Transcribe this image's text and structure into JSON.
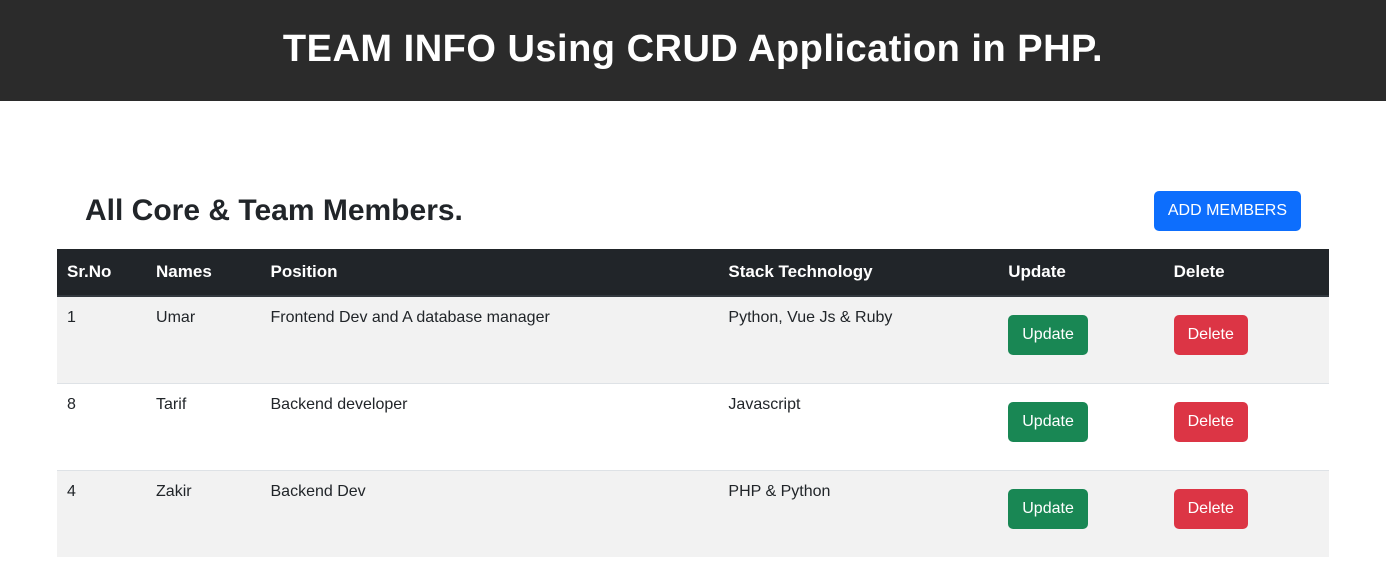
{
  "header": {
    "title": "TEAM INFO Using CRUD Application in PHP."
  },
  "main": {
    "section_title": "All Core & Team Members.",
    "add_button_label": "ADD MEMBERS",
    "columns": {
      "sr": "Sr.No",
      "names": "Names",
      "position": "Position",
      "stack": "Stack Technology",
      "update": "Update",
      "delete": "Delete"
    },
    "buttons": {
      "update_label": "Update",
      "delete_label": "Delete"
    },
    "rows": [
      {
        "sr": "1",
        "name": "Umar",
        "position": "Frontend Dev and A database manager",
        "stack": "Python, Vue Js & Ruby"
      },
      {
        "sr": "8",
        "name": "Tarif",
        "position": "Backend developer",
        "stack": "Javascript"
      },
      {
        "sr": "4",
        "name": "Zakir",
        "position": "Backend Dev",
        "stack": "PHP & Python"
      }
    ]
  }
}
